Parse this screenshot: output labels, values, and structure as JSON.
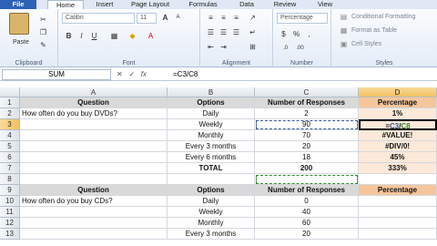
{
  "tabs": [
    "File",
    "Home",
    "Insert",
    "Page Layout",
    "Formulas",
    "Data",
    "Review",
    "View"
  ],
  "ribbon": {
    "paste_label": "Paste",
    "clipboard_label": "Clipboard",
    "font_name": "Calibri",
    "font_size": "11",
    "font_label": "Font",
    "bold": "B",
    "italic": "I",
    "underline": "U",
    "alignment_label": "Alignment",
    "number_format": "Percentage",
    "number_label": "Number",
    "conditional_formatting": "Conditional Formatting",
    "format_as_table": "Format as Table",
    "cell_styles": "Cell Styles",
    "styles_label": "Styles"
  },
  "formula_bar": {
    "name_box": "SUM",
    "cancel": "✕",
    "enter": "✓",
    "fx": "fx",
    "formula": "=C3/C8"
  },
  "columns": [
    "A",
    "B",
    "C",
    "D"
  ],
  "rows": [
    {
      "n": "1",
      "a": "Question",
      "b": "Options",
      "c": "Number of Responses",
      "d": "Percentage",
      "header": true
    },
    {
      "n": "2",
      "a": "How often do you buy DVDs?",
      "b": "Daily",
      "c": "2",
      "d": "1%"
    },
    {
      "n": "3",
      "a": "",
      "b": "Weekly",
      "c": "90",
      "d": "=C3/C8"
    },
    {
      "n": "4",
      "a": "",
      "b": "Monthly",
      "c": "70",
      "d": "#VALUE!"
    },
    {
      "n": "5",
      "a": "",
      "b": "Every 3 months",
      "c": "20",
      "d": "#DIV/0!"
    },
    {
      "n": "6",
      "a": "",
      "b": "Every 6 months",
      "c": "18",
      "d": "45%"
    },
    {
      "n": "7",
      "a": "",
      "b": "TOTAL",
      "c": "200",
      "d": "333%"
    },
    {
      "n": "8",
      "a": "",
      "b": "",
      "c": "",
      "d": ""
    },
    {
      "n": "9",
      "a": "Question",
      "b": "Options",
      "c": "Number of Responses",
      "d": "Percentage",
      "header": true
    },
    {
      "n": "10",
      "a": "How often do you buy CDs?",
      "b": "Daily",
      "c": "0",
      "d": ""
    },
    {
      "n": "11",
      "a": "",
      "b": "Weekly",
      "c": "40",
      "d": ""
    },
    {
      "n": "12",
      "a": "",
      "b": "Monthly",
      "c": "60",
      "d": ""
    },
    {
      "n": "13",
      "a": "",
      "b": "Every 3 months",
      "c": "20",
      "d": ""
    }
  ]
}
